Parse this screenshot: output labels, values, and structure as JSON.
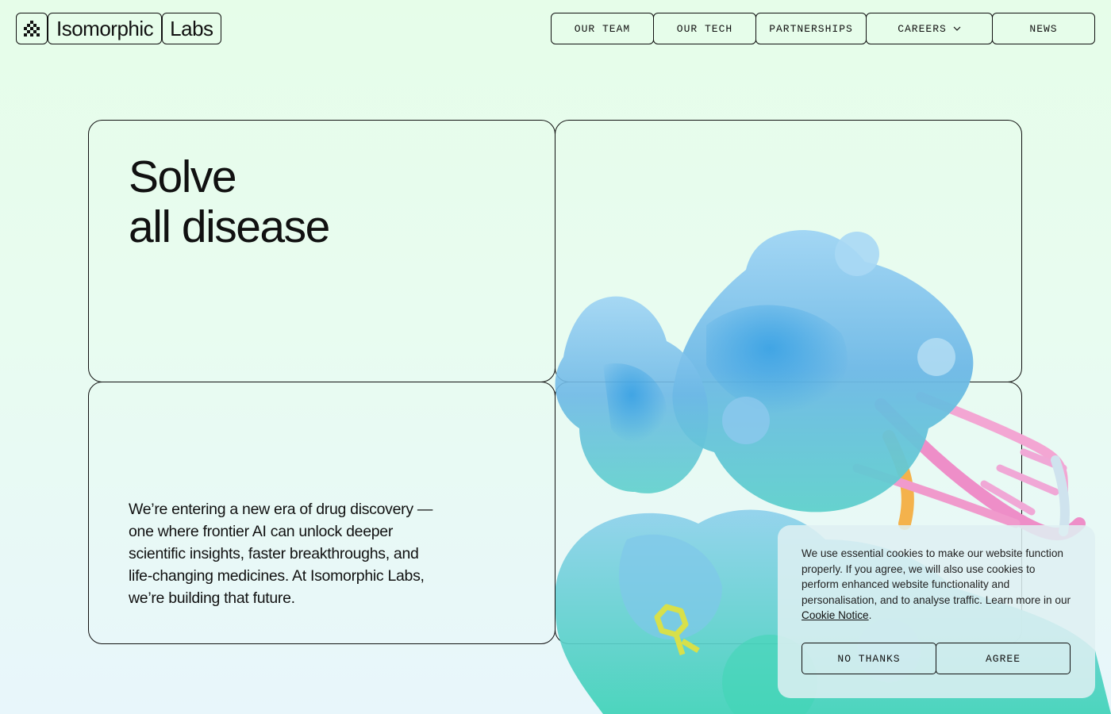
{
  "brand": {
    "name_part1": "Isomorphic",
    "name_part2": "Labs"
  },
  "nav": {
    "items": [
      {
        "label": "OUR TEAM"
      },
      {
        "label": "OUR TECH"
      },
      {
        "label": "PARTNERSHIPS"
      },
      {
        "label": "CAREERS",
        "has_dropdown": true
      },
      {
        "label": "NEWS"
      }
    ]
  },
  "hero": {
    "headline_line1": "Solve",
    "headline_line2": "all disease",
    "intro": "We’re entering a new era of drug discovery — one where frontier AI can unlock deeper scientific insights, faster breakthroughs, and life-changing medicines. At Isomorphic Labs, we’re building that future."
  },
  "cookie_banner": {
    "text_before_link": "We use essential cookies to make our website function properly. If you agree, we will also use cookies to perform enhanced website functionality and personalisation, and to analyse traffic. Learn more in our ",
    "link_text": "Cookie Notice",
    "text_after_link": ".",
    "decline_label": "NO THANKS",
    "accept_label": "AGREE"
  },
  "colors": {
    "background_top": "#e6fde9",
    "background_bottom": "#e8f6fb",
    "ink": "#111111",
    "protein_blue": "#6fb8e8",
    "protein_teal": "#4fd6c4",
    "dna_pink": "#ee8ec8",
    "dna_orange": "#f4b24c",
    "ligand_yellow": "#d8e04a"
  },
  "icons": {
    "logo": "isomorphic-logo-icon",
    "dropdown": "chevron-down-icon"
  }
}
